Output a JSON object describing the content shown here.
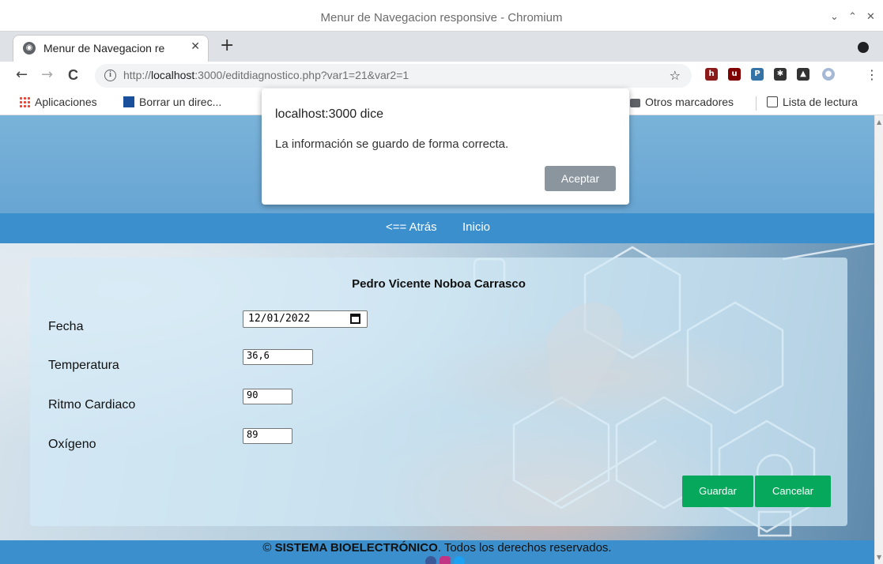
{
  "window": {
    "title": "Menur de Navegacion responsive - Chromium",
    "controls": [
      "⌄",
      "⌃",
      "✕"
    ]
  },
  "tabs": [
    {
      "title": "Menur de Navegacion re",
      "close": "✕"
    }
  ],
  "newtab_label": "+",
  "toolbar": {
    "back": "←",
    "forward": "→",
    "reload": "C",
    "url_prefix": "http://",
    "url_host": "localhost",
    "url_rest": ":3000/editdiagnostico.php?var1=21&var2=1",
    "bookmark_star": "☆",
    "menu": "⋮"
  },
  "extensions": [
    {
      "name": "h-extension-icon",
      "color": "#8b1a1a",
      "glyph": "h"
    },
    {
      "name": "ublock-icon",
      "color": "#800000",
      "glyph": "u"
    },
    {
      "name": "python-icon",
      "color": "#3572a5",
      "glyph": "P"
    },
    {
      "name": "puzzle-icon",
      "color": "#333333",
      "glyph": "✱"
    },
    {
      "name": "flask-icon",
      "color": "#333333",
      "glyph": "▲"
    },
    {
      "name": "profile-icon",
      "color": "#a5b8d6",
      "glyph": "●"
    }
  ],
  "bookmarks": {
    "apps": "Aplicaciones",
    "item1": "Borrar un direc...",
    "other": "Otros marcadores",
    "reading": "Lista de lectura"
  },
  "dialog": {
    "title": "localhost:3000 dice",
    "message": "La información se guardo de forma correcta.",
    "button": "Aceptar"
  },
  "nav": {
    "back": "<== Atrás",
    "home": "Inicio"
  },
  "form": {
    "patient_name": "Pedro Vicente Noboa Carrasco",
    "fields": [
      {
        "label": "Fecha",
        "value": "12/01/2022"
      },
      {
        "label": "Temperatura",
        "value": "36,6"
      },
      {
        "label": "Ritmo Cardiaco",
        "value": "90"
      },
      {
        "label": "Oxígeno",
        "value": "89"
      }
    ],
    "save": "Guardar",
    "cancel": "Cancelar"
  },
  "footer": {
    "copyright_symbol": "©",
    "brand": "SISTEMA BIOELECTRÓNICO",
    "rest": ". Todos los derechos reservados.",
    "social": [
      "facebook-icon",
      "instagram-icon",
      "twitter-icon"
    ]
  },
  "colors": {
    "nav_blue": "#3b8fcc",
    "button_green": "#06a85b",
    "dialog_button": "#8b959e"
  }
}
